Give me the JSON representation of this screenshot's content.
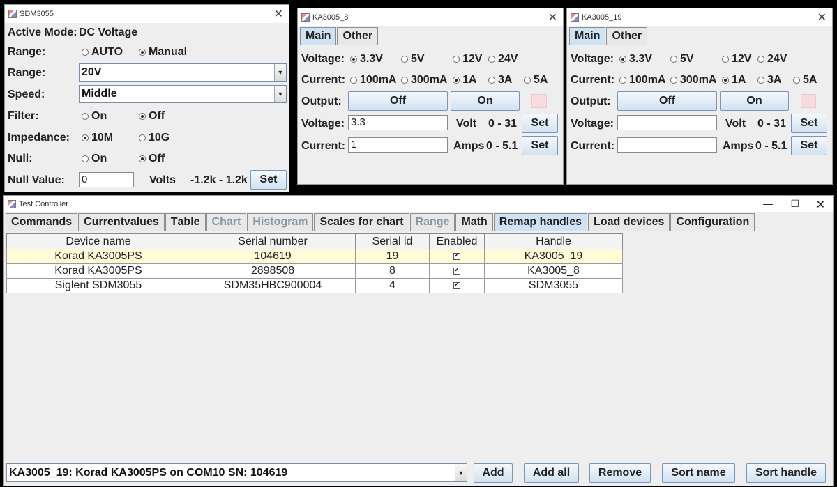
{
  "sdm": {
    "title": "SDM3055",
    "active_mode_label": "Active Mode:",
    "active_mode_value": "DC Voltage",
    "range_label": "Range:",
    "range_auto": "AUTO",
    "range_manual": "Manual",
    "range_combo_label": "Range:",
    "range_value": "20V",
    "speed_label": "Speed:",
    "speed_value": "Middle",
    "filter_label": "Filter:",
    "filter_on": "On",
    "filter_off": "Off",
    "impedance_label": "Impedance:",
    "imp_10m": "10M",
    "imp_10g": "10G",
    "null_label": "Null:",
    "null_on": "On",
    "null_off": "Off",
    "null_value_label": "Null Value:",
    "null_value": "0",
    "volts_label": "Volts",
    "range_hint": "-1.2k - 1.2k",
    "set_label": "Set"
  },
  "ka8": {
    "title": "KA3005_8",
    "tab_main": "Main",
    "tab_other": "Other",
    "voltage_label": "Voltage:",
    "v_opts": [
      "3.3V",
      "5V",
      "12V",
      "24V"
    ],
    "current_label": "Current:",
    "c_opts": [
      "100mA",
      "300mA",
      "1A",
      "3A",
      "5A"
    ],
    "output_label": "Output:",
    "off_label": "Off",
    "on_label": "On",
    "voltage_field_label": "Voltage:",
    "voltage_value": "3.3",
    "volt_unit": "Volt",
    "volt_range": "0 - 31",
    "current_field_label": "Current:",
    "current_value": "1",
    "amps_unit": "Amps",
    "amps_range": "0 - 5.1",
    "set_label": "Set"
  },
  "ka19": {
    "title": "KA3005_19",
    "tab_main": "Main",
    "tab_other": "Other",
    "voltage_label": "Voltage:",
    "v_opts": [
      "3.3V",
      "5V",
      "12V",
      "24V"
    ],
    "current_label": "Current:",
    "c_opts": [
      "100mA",
      "300mA",
      "1A",
      "3A",
      "5A"
    ],
    "output_label": "Output:",
    "off_label": "Off",
    "on_label": "On",
    "voltage_field_label": "Voltage:",
    "voltage_value": "",
    "volt_unit": "Volt",
    "volt_range": "0 - 31",
    "current_field_label": "Current:",
    "current_value": "",
    "amps_unit": "Amps",
    "amps_range": "0 - 5.1",
    "set_label": "Set"
  },
  "tc": {
    "title": "Test Controller",
    "tabs": [
      {
        "label": "Commands",
        "ul": "C"
      },
      {
        "label": "Current values",
        "ul": "v"
      },
      {
        "label": "Table",
        "ul": "T"
      },
      {
        "label": "Chart",
        "ul": "a"
      },
      {
        "label": "Histogram",
        "ul": "H"
      },
      {
        "label": "Scales for chart",
        "ul": "S"
      },
      {
        "label": "Range",
        "ul": "R"
      },
      {
        "label": "Math",
        "ul": "M"
      },
      {
        "label": "Remap handles",
        "ul": ""
      },
      {
        "label": "Load devices",
        "ul": "L"
      },
      {
        "label": "Configuration",
        "ul": "C"
      }
    ],
    "columns": [
      "Device name",
      "Serial number",
      "Serial id",
      "Enabled",
      "Handle"
    ],
    "rows": [
      {
        "device": "Korad KA3005PS",
        "serial": "104619",
        "id": "19",
        "handle": "KA3005_19"
      },
      {
        "device": "Korad KA3005PS",
        "serial": "2898508",
        "id": "8",
        "handle": "KA3005_8"
      },
      {
        "device": "Siglent SDM3055",
        "serial": "SDM35HBC900004",
        "id": "4",
        "handle": "SDM3055"
      }
    ],
    "device_combo": "KA3005_19: Korad KA3005PS on COM10  SN: 104619",
    "add": "Add",
    "add_all": "Add all",
    "remove": "Remove",
    "sort_name": "Sort name",
    "sort_handle": "Sort handle"
  }
}
